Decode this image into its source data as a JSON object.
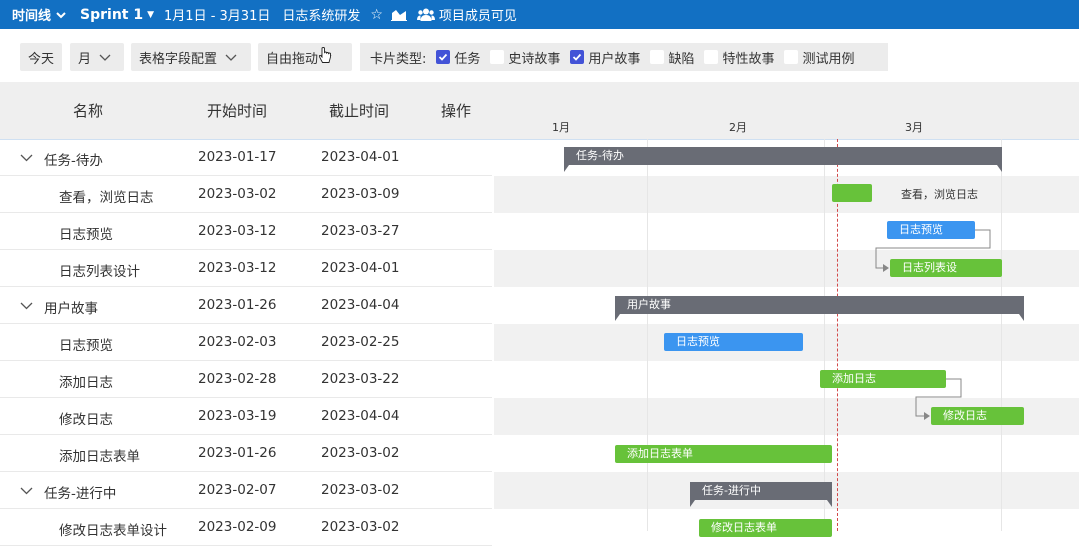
{
  "topbar": {
    "view_label": "时间线",
    "sprint_label": "Sprint 1",
    "date_range": "1月1日 - 3月31日",
    "project_name": "日志系统研发",
    "members_label": "项目成员可见"
  },
  "toolbar": {
    "today_label": "今天",
    "scale_label": "月",
    "field_config_label": "表格字段配置",
    "drag_mode_label": "自由拖动",
    "card_type_label": "卡片类型:",
    "card_types": [
      {
        "label": "任务",
        "checked": true
      },
      {
        "label": "史诗故事",
        "checked": false
      },
      {
        "label": "用户故事",
        "checked": true
      },
      {
        "label": "缺陷",
        "checked": false
      },
      {
        "label": "特性故事",
        "checked": false
      },
      {
        "label": "测试用例",
        "checked": false
      }
    ]
  },
  "columns": {
    "name": "名称",
    "start": "开始时间",
    "end": "截止时间",
    "actions": "操作"
  },
  "timeline": {
    "months": [
      "1月",
      "2月",
      "3月"
    ]
  },
  "rows": [
    {
      "name": "任务-待办",
      "start": "2023-01-17",
      "end": "2023-04-01",
      "group": true
    },
    {
      "name": "查看，浏览日志",
      "start": "2023-03-02",
      "end": "2023-03-09",
      "group": false
    },
    {
      "name": "日志预览",
      "start": "2023-03-12",
      "end": "2023-03-27",
      "group": false
    },
    {
      "name": "日志列表设计",
      "start": "2023-03-12",
      "end": "2023-04-01",
      "group": false
    },
    {
      "name": "用户故事",
      "start": "2023-01-26",
      "end": "2023-04-04",
      "group": true
    },
    {
      "name": "日志预览",
      "start": "2023-02-03",
      "end": "2023-02-25",
      "group": false
    },
    {
      "name": "添加日志",
      "start": "2023-02-28",
      "end": "2023-03-22",
      "group": false
    },
    {
      "name": "修改日志",
      "start": "2023-03-19",
      "end": "2023-04-04",
      "group": false
    },
    {
      "name": "添加日志表单",
      "start": "2023-01-26",
      "end": "2023-03-02",
      "group": false
    },
    {
      "name": "任务-进行中",
      "start": "2023-02-07",
      "end": "2023-03-02",
      "group": true
    },
    {
      "name": "修改日志表单设计",
      "start": "2023-02-09",
      "end": "2023-03-02",
      "group": false
    }
  ],
  "bars": [
    {
      "label": "任务-待办",
      "type": "group",
      "color": "#696c75"
    },
    {
      "label": "查看，浏览日志",
      "type": "task",
      "color": "#67c23a",
      "label_outside": true
    },
    {
      "label": "日志预览",
      "type": "task",
      "color": "#3b95f0"
    },
    {
      "label": "日志列表设",
      "type": "task",
      "color": "#67c23a"
    },
    {
      "label": "用户故事",
      "type": "group",
      "color": "#696c75"
    },
    {
      "label": "日志预览",
      "type": "task",
      "color": "#3b95f0"
    },
    {
      "label": "添加日志",
      "type": "task",
      "color": "#67c23a"
    },
    {
      "label": "修改日志",
      "type": "task",
      "color": "#67c23a"
    },
    {
      "label": "添加日志表单",
      "type": "task",
      "color": "#67c23a"
    },
    {
      "label": "任务-进行中",
      "type": "group",
      "color": "#696c75"
    },
    {
      "label": "修改日志表单",
      "type": "task",
      "color": "#67c23a"
    }
  ],
  "colors": {
    "topbar": "#1270c3",
    "task_green": "#67c23a",
    "task_blue": "#3b95f0",
    "group_gray": "#696c75",
    "checkbox": "#4353d7",
    "today_line": "#d24a4a"
  }
}
